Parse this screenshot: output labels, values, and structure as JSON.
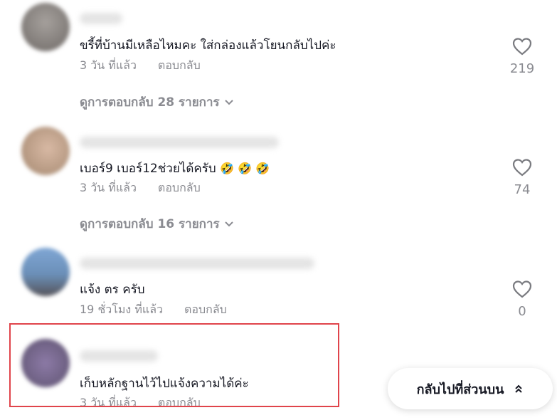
{
  "comments": [
    {
      "text": "ขรี้ที่บ้านมีเหลือไหมคะ ใส่กล่องแล้วโยนกลับไปค่ะ",
      "time": "3 วัน ที่แล้ว",
      "reply_label": "ตอบกลับ",
      "likes": "219",
      "view_replies": "ดูการตอบกลับ 28 รายการ"
    },
    {
      "text": "เบอร์9 เบอร์12ช่วยได้ครับ",
      "emoji": "🤣 🤣 🤣",
      "time": "3 วัน ที่แล้ว",
      "reply_label": "ตอบกลับ",
      "likes": "74",
      "view_replies": "ดูการตอบกลับ 16 รายการ"
    },
    {
      "text": "แจ้ง ตร ครับ",
      "time": "19 ชั่วโมง ที่แล้ว",
      "reply_label": "ตอบกลับ",
      "likes": "0"
    },
    {
      "text": "เก็บหลักฐานไว้ไปแจ้งความได้ค่ะ",
      "time": "3 วัน ที่แล้ว",
      "reply_label": "ตอบกลับ"
    }
  ],
  "back_to_top": {
    "label": "กลับไปที่ส่วนบน",
    "icon": "double-chevron-up-icon"
  },
  "colors": {
    "highlight": "#e0444b",
    "meta": "#8a8b91",
    "text": "#161823"
  }
}
